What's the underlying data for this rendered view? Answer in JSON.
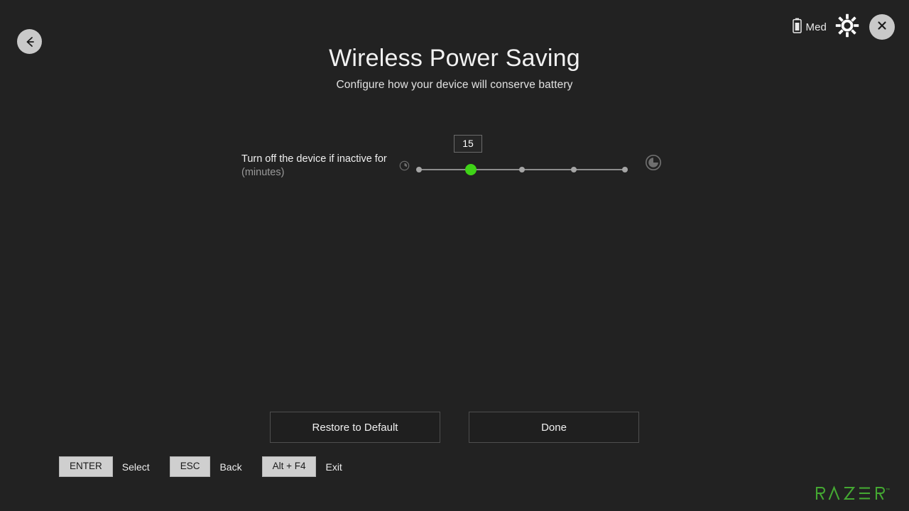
{
  "window": {
    "title": "Wireless Power Saving",
    "subtitle": "Configure how your device will conserve battery",
    "background_color": "#222222"
  },
  "topbar": {
    "back_icon": "arrow-left-icon",
    "battery": {
      "icon": "battery-icon",
      "level_label": "Med"
    },
    "settings_icon": "gear-icon",
    "close_icon": "close-icon"
  },
  "setting": {
    "label_main": "Turn off the device if inactive for ",
    "label_unit": "(minutes)",
    "label_icon": "clock-icon-small",
    "end_icon": "clock-icon-large",
    "slider": {
      "value": "15",
      "value_number": 15,
      "tick_count": 5,
      "selected_tick_index": 1,
      "thumb_color": "#3fd317",
      "track_color": "#8d8d8d",
      "tick_color": "#a5a5a5"
    }
  },
  "actions": {
    "restore_label": "Restore to Default",
    "done_label": "Done"
  },
  "key_hints": [
    {
      "key": "ENTER",
      "action": "Select"
    },
    {
      "key": "ESC",
      "action": "Back"
    },
    {
      "key": "Alt + F4",
      "action": "Exit"
    }
  ],
  "brand": {
    "name": "RAZER",
    "color": "#44a832"
  }
}
